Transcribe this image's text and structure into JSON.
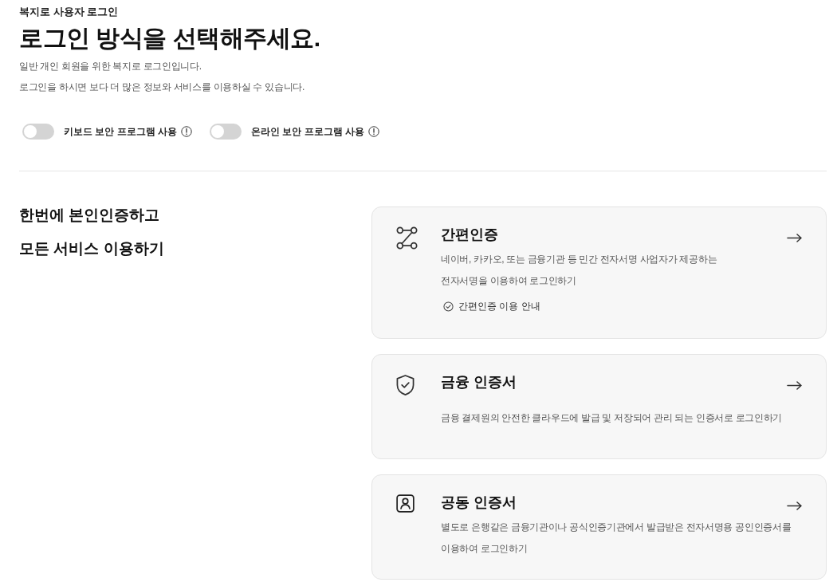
{
  "header": {
    "eyebrow": "복지로 사용자 로그인",
    "title": "로그인 방식을 선택해주세요.",
    "lines": [
      "일반 개인 회원을 위한 복지로 로그인입니다.",
      "로그인을 하시면 보다 더 많은 정보와 서비스를 이용하실 수 있습니다."
    ]
  },
  "toggles": [
    {
      "label": "키보드 보안 프로그램 사용",
      "on": false
    },
    {
      "label": "온라인 보안 프로그램 사용",
      "on": false
    }
  ],
  "intro": {
    "lines": [
      "한번에 본인인증하고",
      "모든 서비스 이용하기"
    ]
  },
  "methods": [
    {
      "kind": "simple",
      "title": "간편인증",
      "description": [
        "네이버, 카카오, 또는 금융기관 등 민간 전자서명 사업자가 제공하는",
        "전자서명을 이용하여 로그인하기"
      ],
      "guide_link": "간편인증 이용 안내"
    },
    {
      "kind": "financial",
      "title": "금융 인증서",
      "description": [
        "금융 결제원의 안전한 클라우드에 발급 및 저장되어 관리 되는 인증서로 로그인하기"
      ]
    },
    {
      "kind": "joint",
      "title": "공동 인증서",
      "description": [
        "별도로 은행같은 금융기관이나 공식인증기관에서 발급받은 전자서명용 공인인증서를",
        "이용하여 로그인하기"
      ]
    }
  ]
}
